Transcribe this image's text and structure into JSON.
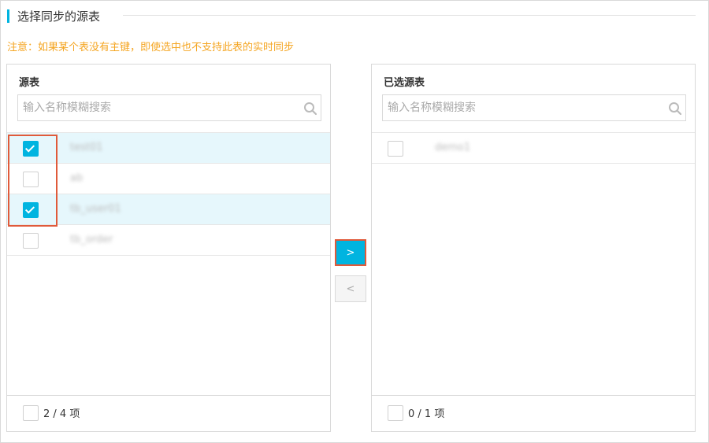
{
  "section": {
    "title": "选择同步的源表"
  },
  "notice": "注意：如果某个表没有主键，即使选中也不支持此表的实时同步",
  "source_panel": {
    "header": "源表",
    "search_placeholder": "输入名称模糊搜索",
    "items": [
      {
        "name": "test01",
        "checked": true
      },
      {
        "name": "ab",
        "checked": false
      },
      {
        "name": "tb_user01",
        "checked": true
      },
      {
        "name": "tb_order",
        "checked": false
      }
    ],
    "footer_count": "2 / 4 项"
  },
  "selected_panel": {
    "header": "已选源表",
    "search_placeholder": "输入名称模糊搜索",
    "items": [
      {
        "name": "demo1",
        "checked": false
      }
    ],
    "footer_count": "0 / 1 项"
  },
  "buttons": {
    "move_right": ">",
    "move_left": "<"
  },
  "colors": {
    "accent": "#00b4e0",
    "notice": "#f5a623",
    "highlight": "#e05a3a",
    "selected_row": "#e6f7fc"
  }
}
